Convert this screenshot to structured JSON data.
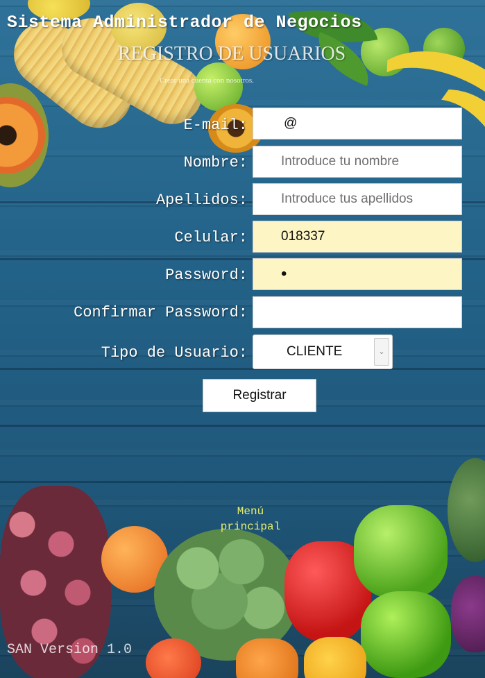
{
  "header": {
    "title": "Sistema Administrador de Negocios",
    "subtitle": "REGISTRO DE USUARIOS",
    "tagline": "Crear una cuenta con nosotros."
  },
  "form": {
    "email": {
      "label": "E-mail:",
      "value": "@"
    },
    "nombre": {
      "label": "Nombre:",
      "placeholder": "Introduce tu nombre"
    },
    "apellidos": {
      "label": "Apellidos:",
      "placeholder": "Introduce tus apellidos"
    },
    "celular": {
      "label": "Celular:",
      "value": "018337"
    },
    "password": {
      "label": "Password:",
      "value": "•"
    },
    "confirm_password": {
      "label": "Confirmar Password:",
      "value": ""
    },
    "tipo_usuario": {
      "label": "Tipo de Usuario:",
      "selected": "CLIENTE"
    },
    "submit_label": "Registrar"
  },
  "footer": {
    "menu_link": "Menú principal",
    "version": "SAN Version 1.0"
  },
  "colors": {
    "background": "#1f5f86",
    "autofill": "#fdf6c4",
    "link": "#e9f06a"
  }
}
